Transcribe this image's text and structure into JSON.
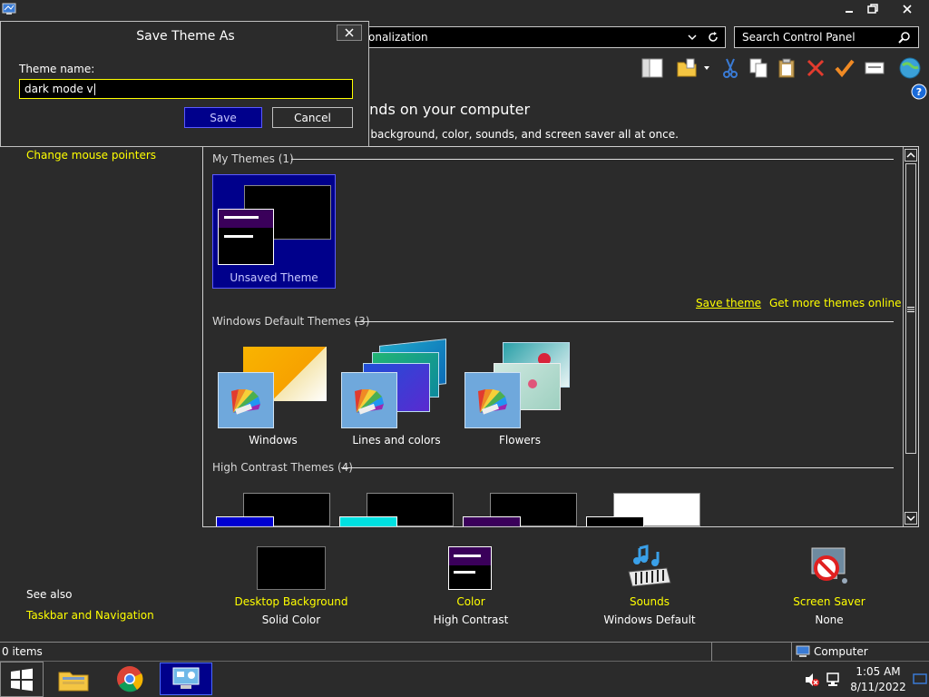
{
  "window": {
    "address_text": "onalization",
    "search_placeholder": "Search Control Panel",
    "page_title": "unds on your computer",
    "page_subtitle": "p background, color, sounds, and screen saver all at once.",
    "sidebar_link_mouse": "Change mouse pointers",
    "see_also": "See also",
    "sidebar_link_taskbar": "Taskbar and Navigation"
  },
  "dialog": {
    "title": "Save Theme As",
    "field_label": "Theme name:",
    "field_value": "dark mode v",
    "save_label": "Save",
    "cancel_label": "Cancel"
  },
  "themes": {
    "my_themes_title": "My Themes (1)",
    "unsaved_label": "Unsaved Theme",
    "save_theme_link": "Save theme",
    "get_more_link": "Get more themes online",
    "default_title": "Windows Default Themes (3)",
    "defaults": [
      "Windows",
      "Lines and colors",
      "Flowers"
    ],
    "high_contrast_title": "High Contrast Themes (4)"
  },
  "bottom": {
    "items": [
      {
        "title": "Desktop Background",
        "value": "Solid Color"
      },
      {
        "title": "Color",
        "value": "High Contrast"
      },
      {
        "title": "Sounds",
        "value": "Windows Default"
      },
      {
        "title": "Screen Saver",
        "value": "None"
      }
    ]
  },
  "status": {
    "items_text": "0 items",
    "computer_text": "Computer"
  },
  "tray": {
    "time": "1:05 AM",
    "date": "8/11/2022"
  },
  "colors": {
    "accent_yellow": "#ffff00",
    "selection_blue": "#00008b",
    "dark_bg": "#2b2b2b"
  }
}
